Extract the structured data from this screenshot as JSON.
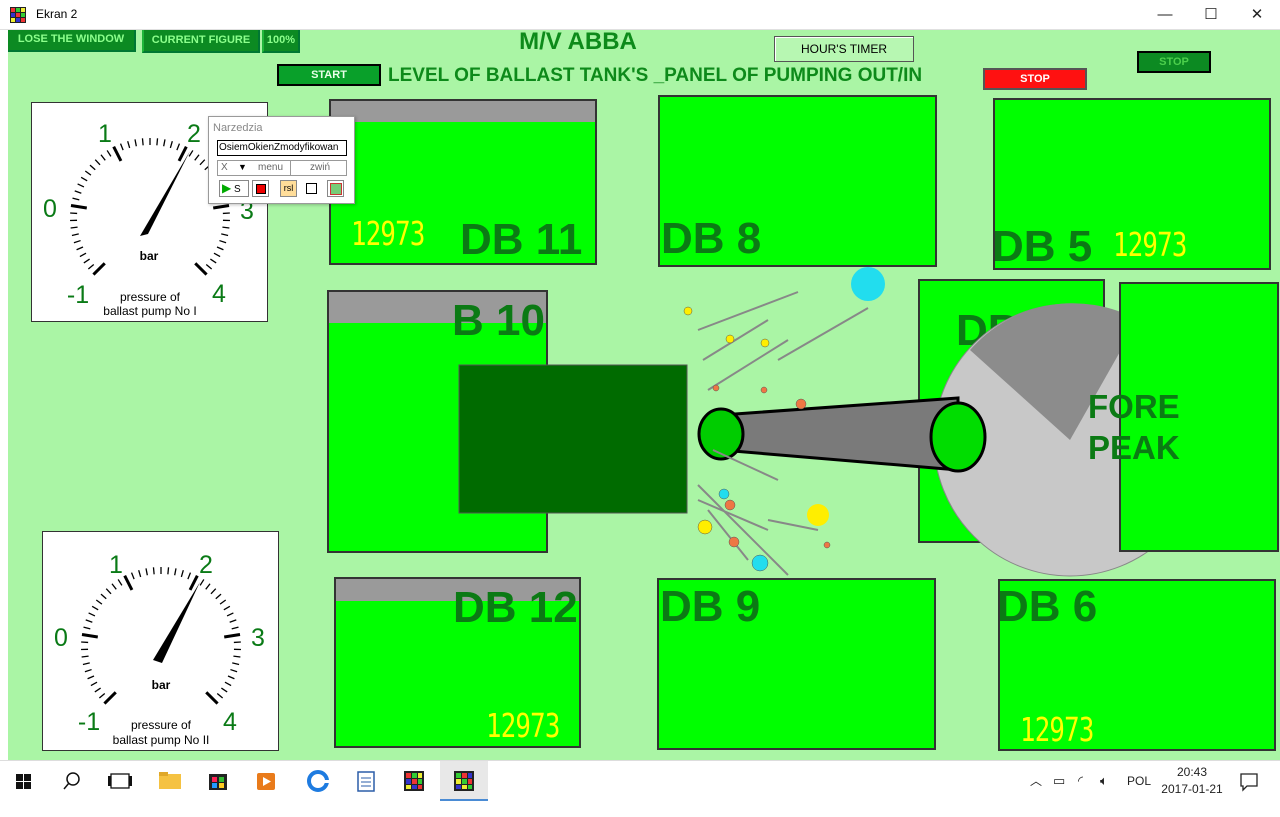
{
  "window": {
    "title": "Ekran 2",
    "minimize_glyph": "—",
    "maximize_glyph": "☐",
    "close_glyph": "✕"
  },
  "toolbar": {
    "close_window": "LOSE THE WINDOW",
    "current_figure": "CURRENT FIGURE",
    "zoom": "100%",
    "start": "START",
    "stop": "STOP",
    "stop_right": "STOP",
    "hours_timer": "HOUR'S TIMER"
  },
  "header": {
    "ship_name": "M/V ABBA",
    "panel_title": "LEVEL OF BALLAST TANK'S _PANEL OF PUMPING OUT/IN"
  },
  "gauges": [
    {
      "value_bar": 2,
      "scale": [
        "-1",
        "0",
        "1",
        "2",
        "3",
        "4"
      ],
      "unit": "bar",
      "caption_line1": "pressure of",
      "caption_line2": "ballast pump No I"
    },
    {
      "value_bar": 2,
      "scale": [
        "-1",
        "0",
        "1",
        "2",
        "3",
        "4"
      ],
      "unit": "bar",
      "caption_line1": "pressure of",
      "caption_line2": "ballast pump No II"
    }
  ],
  "tanks": {
    "db11": {
      "label": "DB 11",
      "fill_fraction": 0.87,
      "reading": "12973"
    },
    "db8": {
      "label": "DB 8",
      "fill_fraction": 1.0
    },
    "db5": {
      "label": "DB 5",
      "fill_fraction": 1.0,
      "reading": "12973"
    },
    "db10": {
      "label": "B 10",
      "fill_fraction": 0.88
    },
    "db4": {
      "label": "DB 4",
      "fill_fraction": 1.0
    },
    "fore_peak": {
      "label_line1": "FORE",
      "label_line2": "PEAK",
      "fill_fraction": 1.0
    },
    "db12": {
      "label": "DB 12",
      "fill_fraction": 0.87,
      "reading": "12973"
    },
    "db9": {
      "label": "DB 9",
      "fill_fraction": 1.0
    },
    "db6": {
      "label": "DB 6",
      "fill_fraction": 1.0,
      "reading": "12973"
    }
  },
  "toolbox": {
    "title": "Narzedzia",
    "input_value": "OsiemOkienZmodyfikowan",
    "close_glyph": "X",
    "menu_label": "menu",
    "collapse_label": "zwiń",
    "play_label": "S",
    "rsl_label": "rsl"
  },
  "taskbar": {
    "language": "POL",
    "time": "20:43",
    "date": "2017-01-21"
  },
  "colors": {
    "background": "#aaf5a5",
    "tank_fill": "#00ff00",
    "tank_empty": "#9a9a9a",
    "label_green": "#0b7a14",
    "reading_yellow": "#ffff00",
    "stop_red": "#ff1111"
  }
}
